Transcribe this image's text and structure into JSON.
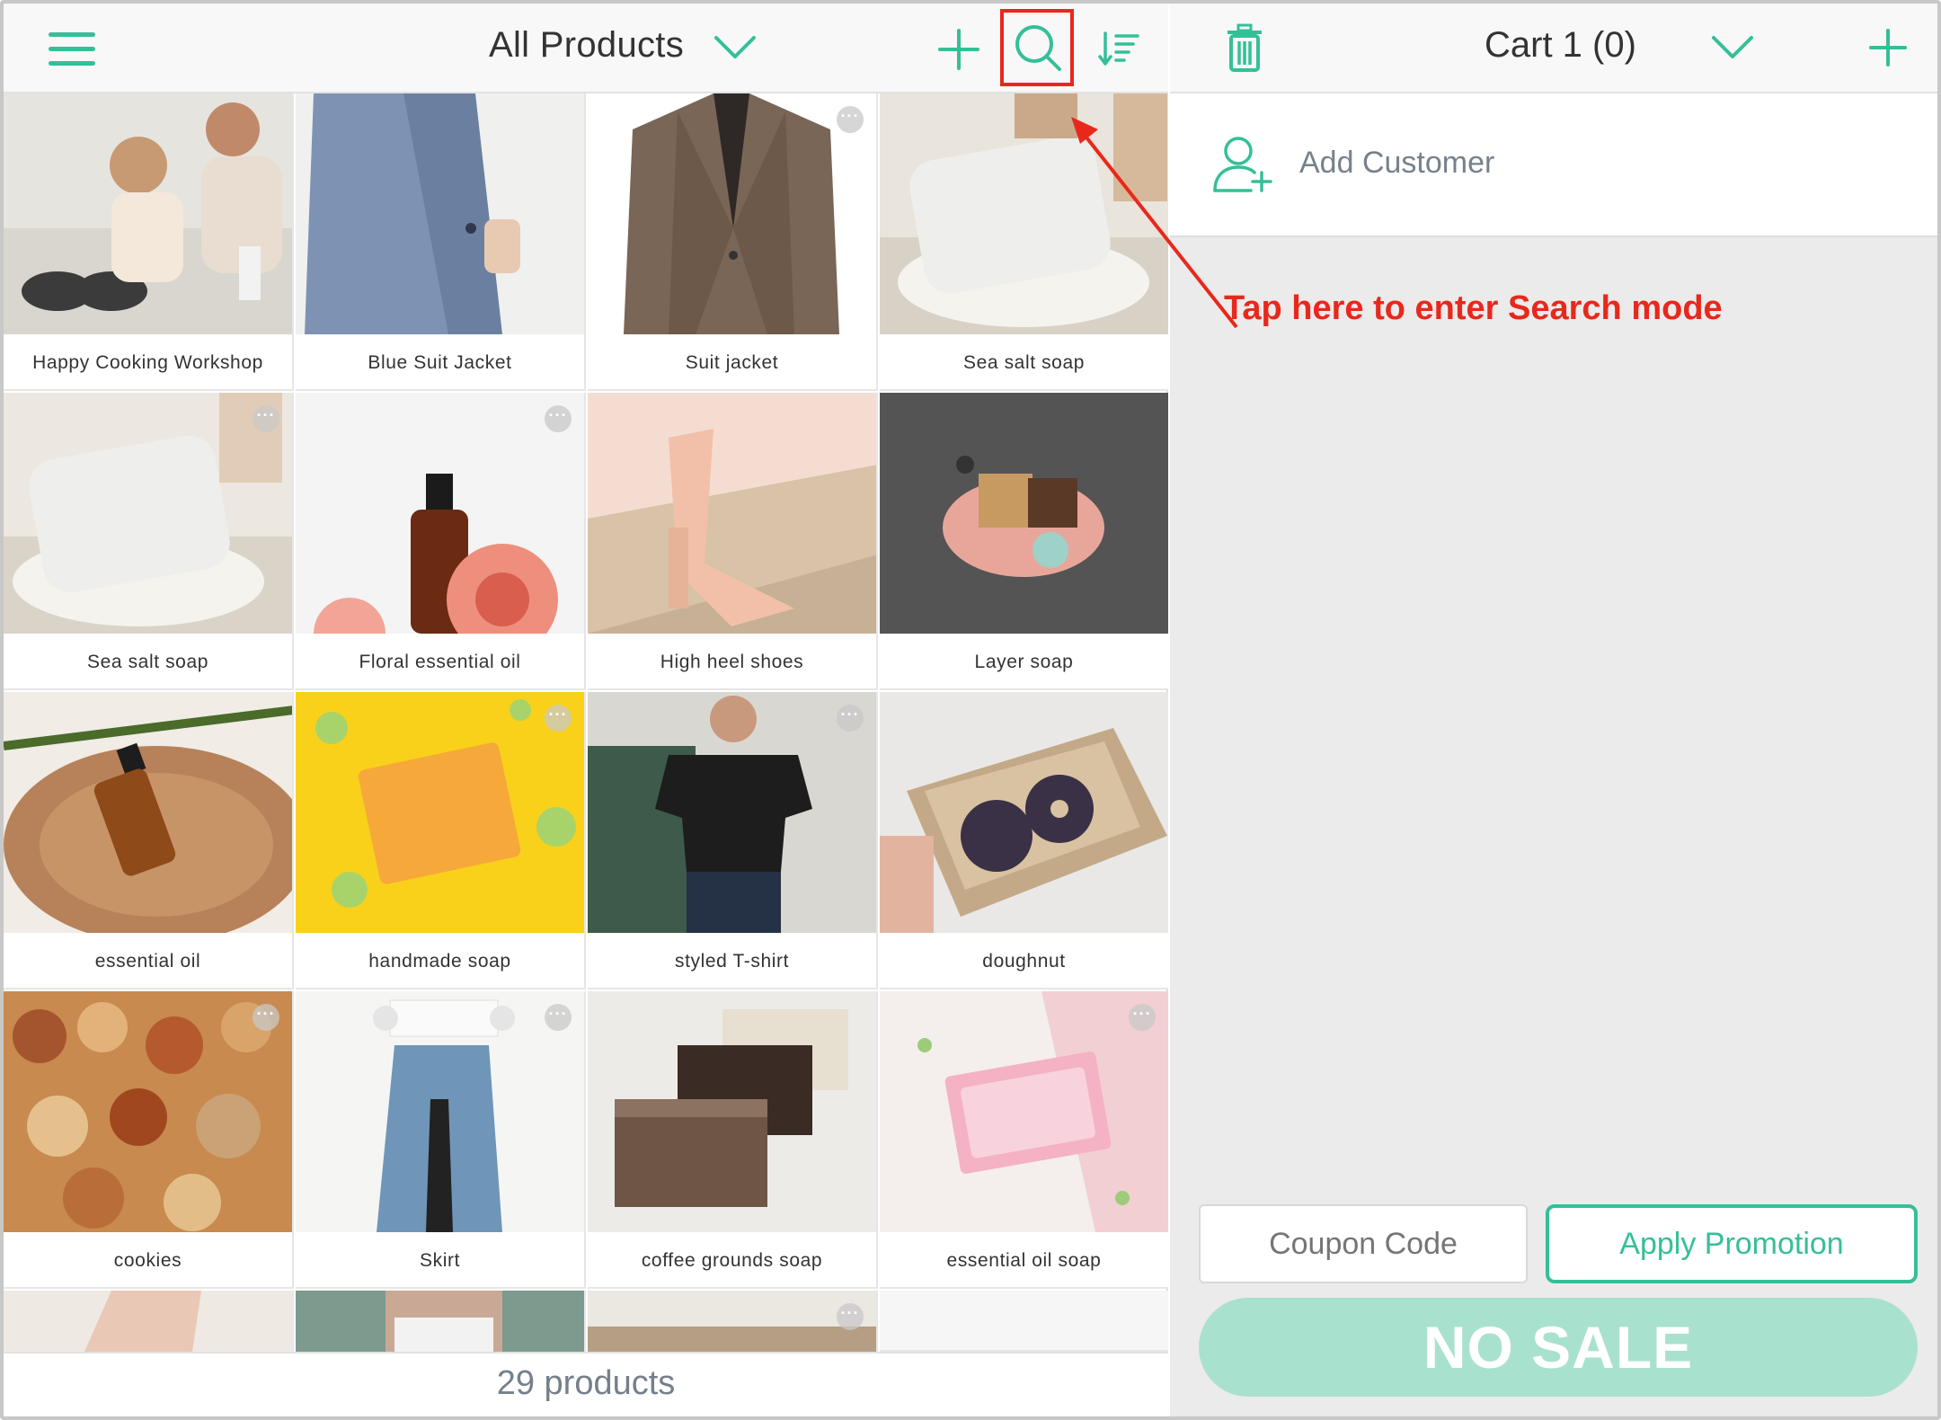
{
  "header": {
    "menu_icon": "hamburger-icon",
    "title": "All Products",
    "dropdown_icon": "chevron-down-icon",
    "add_icon": "plus-icon",
    "search_icon": "search-icon",
    "sort_icon": "sort-icon"
  },
  "products": [
    {
      "name": "Happy Cooking Workshop",
      "more": false
    },
    {
      "name": "Blue Suit Jacket",
      "more": false
    },
    {
      "name": "Suit jacket",
      "more": true
    },
    {
      "name": "Sea salt soap",
      "more": false
    },
    {
      "name": "Sea salt soap",
      "more": true
    },
    {
      "name": "Floral essential oil",
      "more": true
    },
    {
      "name": "High heel shoes",
      "more": false
    },
    {
      "name": "Layer soap",
      "more": false
    },
    {
      "name": "essential oil",
      "more": false
    },
    {
      "name": "handmade soap",
      "more": true
    },
    {
      "name": "styled T-shirt",
      "more": true
    },
    {
      "name": "doughnut",
      "more": false
    },
    {
      "name": "cookies",
      "more": true
    },
    {
      "name": "Skirt",
      "more": true
    },
    {
      "name": "coffee grounds soap",
      "more": false
    },
    {
      "name": "essential oil soap",
      "more": true
    }
  ],
  "footer": {
    "count": "29 products"
  },
  "cart": {
    "trash_icon": "trash-icon",
    "title": "Cart 1 (0)",
    "dropdown_icon": "chevron-down-icon",
    "add_icon": "plus-icon",
    "add_customer": "Add Customer",
    "coupon_placeholder": "Coupon Code",
    "apply_label": "Apply Promotion",
    "nosale_label": "NO SALE"
  },
  "annotation": {
    "text": "Tap here to enter Search mode"
  },
  "colors": {
    "accent": "#35bf98",
    "highlight": "#e8281b",
    "nosale_bg": "#a9e1cf"
  }
}
